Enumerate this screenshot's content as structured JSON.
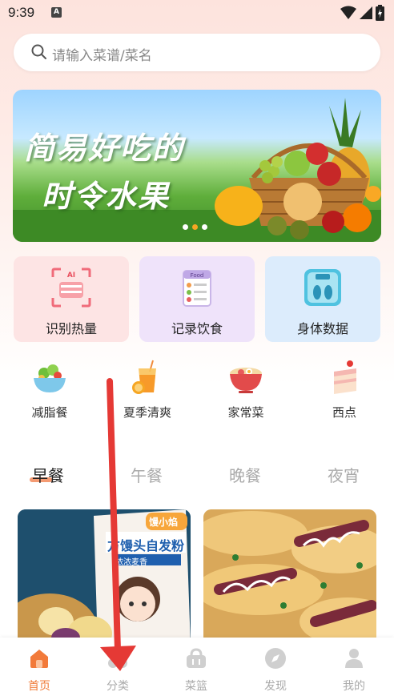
{
  "status": {
    "time": "9:39",
    "notif_glyph": "A"
  },
  "search": {
    "placeholder": "请输入菜谱/菜名"
  },
  "banner": {
    "line1": "简易好吃的",
    "line2": "时令水果",
    "dots": 3,
    "active_dot": 1
  },
  "features": [
    {
      "label": "识别热量",
      "icon": "ai-scan-icon",
      "badge": "AI",
      "bg": "#fde4e4"
    },
    {
      "label": "记录饮食",
      "icon": "food-notebook-icon",
      "badge": "Food",
      "bg": "#efe3fa"
    },
    {
      "label": "身体数据",
      "icon": "scale-icon",
      "bg": "#dcecfc"
    }
  ],
  "categories": [
    {
      "label": "减脂餐",
      "icon": "salad-bowl-icon"
    },
    {
      "label": "夏季清爽",
      "icon": "juice-glass-icon"
    },
    {
      "label": "家常菜",
      "icon": "noodle-bowl-icon"
    },
    {
      "label": "西点",
      "icon": "cake-icon"
    }
  ],
  "meal_tabs": [
    {
      "label": "早餐",
      "active": true
    },
    {
      "label": "午餐",
      "active": false
    },
    {
      "label": "晚餐",
      "active": false
    },
    {
      "label": "夜宵",
      "active": false
    }
  ],
  "recipe_cards": [
    {
      "package_brand": "馒小焰",
      "package_text": "方馒头自发粉",
      "package_sub": "浓浓麦香"
    },
    {
      "image": "bread-rolls"
    }
  ],
  "nav": [
    {
      "label": "首页",
      "icon": "home-icon",
      "active": true
    },
    {
      "label": "分类",
      "icon": "category-icon",
      "active": false
    },
    {
      "label": "菜篮",
      "icon": "basket-icon",
      "active": false
    },
    {
      "label": "发现",
      "icon": "compass-icon",
      "active": false
    },
    {
      "label": "我的",
      "icon": "profile-icon",
      "active": false
    }
  ],
  "colors": {
    "accent": "#f07c3a",
    "annotation_arrow": "#e53935"
  }
}
